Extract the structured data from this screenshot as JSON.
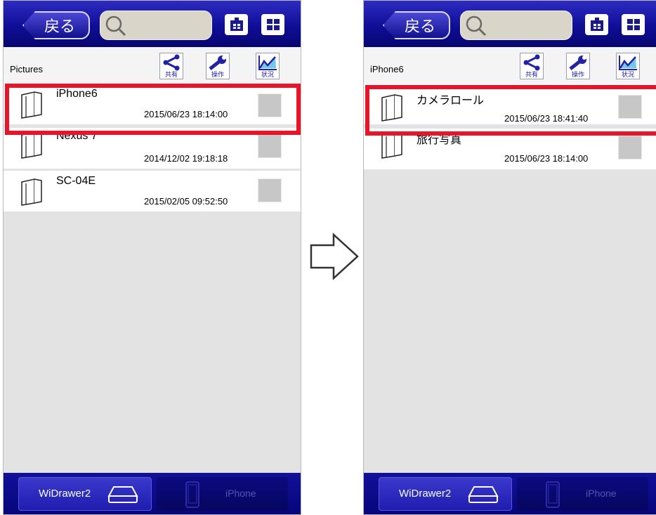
{
  "screens": [
    {
      "back_label": "戻る",
      "path": "Pictures",
      "toolbar": {
        "share": "共有",
        "operate": "操作",
        "status": "状況"
      },
      "items": [
        {
          "name": "iPhone6",
          "date": "2015/06/23 18:14:00"
        },
        {
          "name": "Nexus 7",
          "date": "2014/12/02 19:18:18"
        },
        {
          "name": "SC-04E",
          "date": "2015/02/05 09:52:50"
        }
      ],
      "tabs": {
        "widrawer": "WiDrawer2",
        "iphone": "iPhone"
      }
    },
    {
      "back_label": "戻る",
      "path": "iPhone6",
      "toolbar": {
        "share": "共有",
        "operate": "操作",
        "status": "状況"
      },
      "items": [
        {
          "name": "カメラロール",
          "date": "2015/06/23 18:41:40"
        },
        {
          "name": "旅行写真",
          "date": "2015/06/23 18:14:00"
        }
      ],
      "tabs": {
        "widrawer": "WiDrawer2",
        "iphone": "iPhone"
      }
    }
  ],
  "colors": {
    "bar": "#0f0e98",
    "highlight": "#e8142a",
    "list_bg": "#e3e3e3"
  },
  "icons": [
    "search-icon",
    "home-icon",
    "grid-icon",
    "share-icon",
    "wrench-icon",
    "chart-icon",
    "folder-icon",
    "drive-icon",
    "phone-icon",
    "right-arrow-icon"
  ]
}
